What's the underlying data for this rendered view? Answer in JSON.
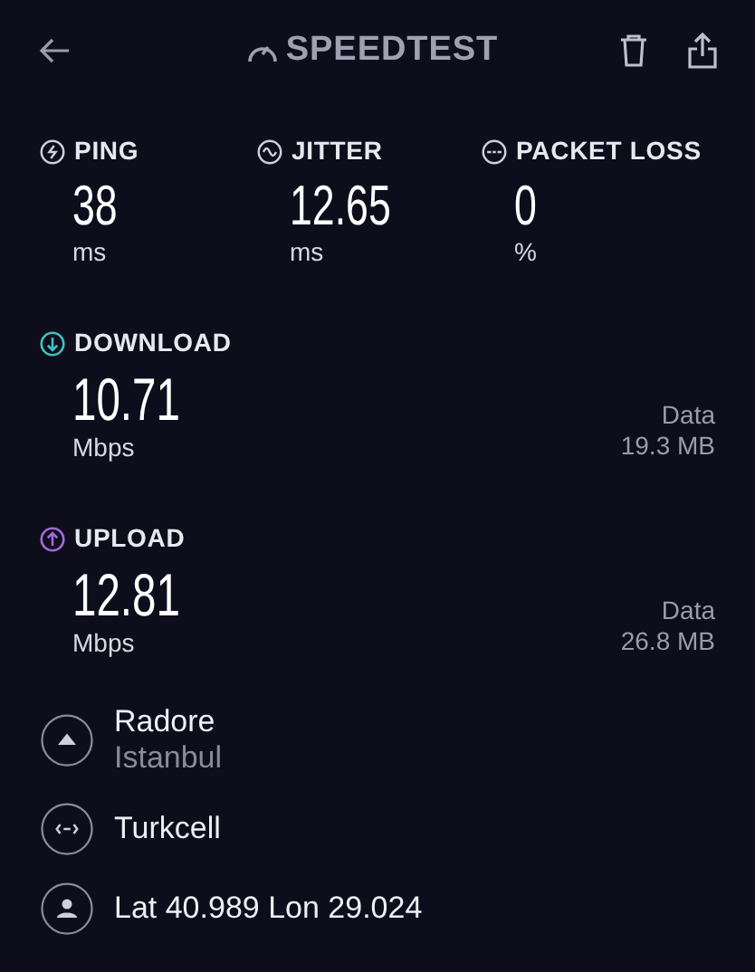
{
  "header": {
    "title": "SPEEDTEST"
  },
  "metrics": [
    {
      "kind": "ping",
      "label": "PING",
      "value": "38",
      "unit": "ms"
    },
    {
      "kind": "jitter",
      "label": "JITTER",
      "value": "12.65",
      "unit": "ms"
    },
    {
      "kind": "loss",
      "label": "PACKET LOSS",
      "value": "0",
      "unit": "%"
    }
  ],
  "transfers": [
    {
      "kind": "download",
      "label": "DOWNLOAD",
      "color": "#3fc1c0",
      "value": "10.71",
      "unit": "Mbps",
      "data_label": "Data",
      "data_value": "19.3 MB"
    },
    {
      "kind": "upload",
      "label": "UPLOAD",
      "color": "#a46ad8",
      "value": "12.81",
      "unit": "Mbps",
      "data_label": "Data",
      "data_value": "26.8 MB"
    }
  ],
  "info": [
    {
      "kind": "server",
      "title": "Radore",
      "subtitle": "Istanbul"
    },
    {
      "kind": "provider",
      "title": "Turkcell"
    },
    {
      "kind": "location",
      "title": "Lat 40.989 Lon 29.024"
    }
  ]
}
